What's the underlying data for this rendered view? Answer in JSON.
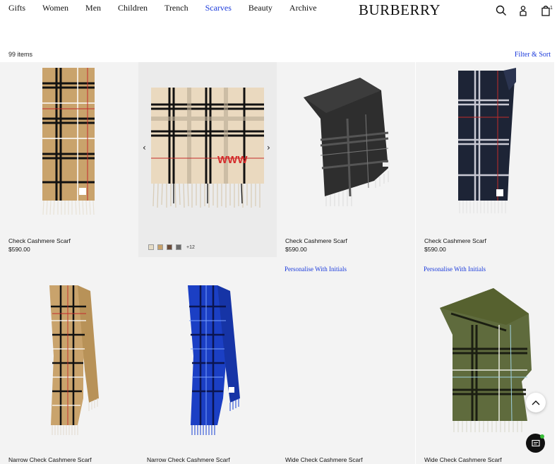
{
  "nav": {
    "items": [
      "Gifts",
      "Women",
      "Men",
      "Children",
      "Trench",
      "Scarves",
      "Beauty",
      "Archive"
    ],
    "active": "Scarves"
  },
  "brand": "BURBERRY",
  "header_icons": [
    "search-icon",
    "account-icon",
    "bag-icon"
  ],
  "cart_count": "1",
  "listing": {
    "items_count": "99 items",
    "filter_label": "Filter & Sort"
  },
  "products": [
    {
      "name": "Check Cashmere Scarf",
      "price": "$590.00",
      "image": "archive-beige-check-scarf"
    },
    {
      "name": "",
      "price": "",
      "image": "beige-check-scarf-with-red-initials",
      "monogram": "WWW",
      "swatch_more": "+12"
    },
    {
      "name": "Check Cashmere Scarf",
      "price": "$590.00",
      "image": "charcoal-check-scarf"
    },
    {
      "name": "Check Cashmere Scarf",
      "price": "$590.00",
      "image": "navy-check-scarf"
    },
    {
      "name": "Narrow Check Cashmere Scarf",
      "price": "",
      "image": "beige-narrow-check-scarf"
    },
    {
      "name": "Narrow Check Cashmere Scarf",
      "price": "",
      "image": "blue-narrow-check-scarf"
    },
    {
      "name": "Wide Check Cashmere Scarf",
      "price": "",
      "image": "beige-wide-check-scarf",
      "badge": "Personalise With Initials"
    },
    {
      "name": "Wide Check Cashmere Scarf",
      "price": "",
      "image": "green-wide-check-scarf",
      "badge": "Personalise With Initials"
    }
  ],
  "colors": {
    "accent": "#1a3adb",
    "tile_bg": "#f3f3f3",
    "archive_beige": "#c9a36c",
    "charcoal": "#2e2e2e",
    "navy": "#1d2436",
    "blue": "#1b3fc4",
    "green": "#5f6b3d"
  }
}
